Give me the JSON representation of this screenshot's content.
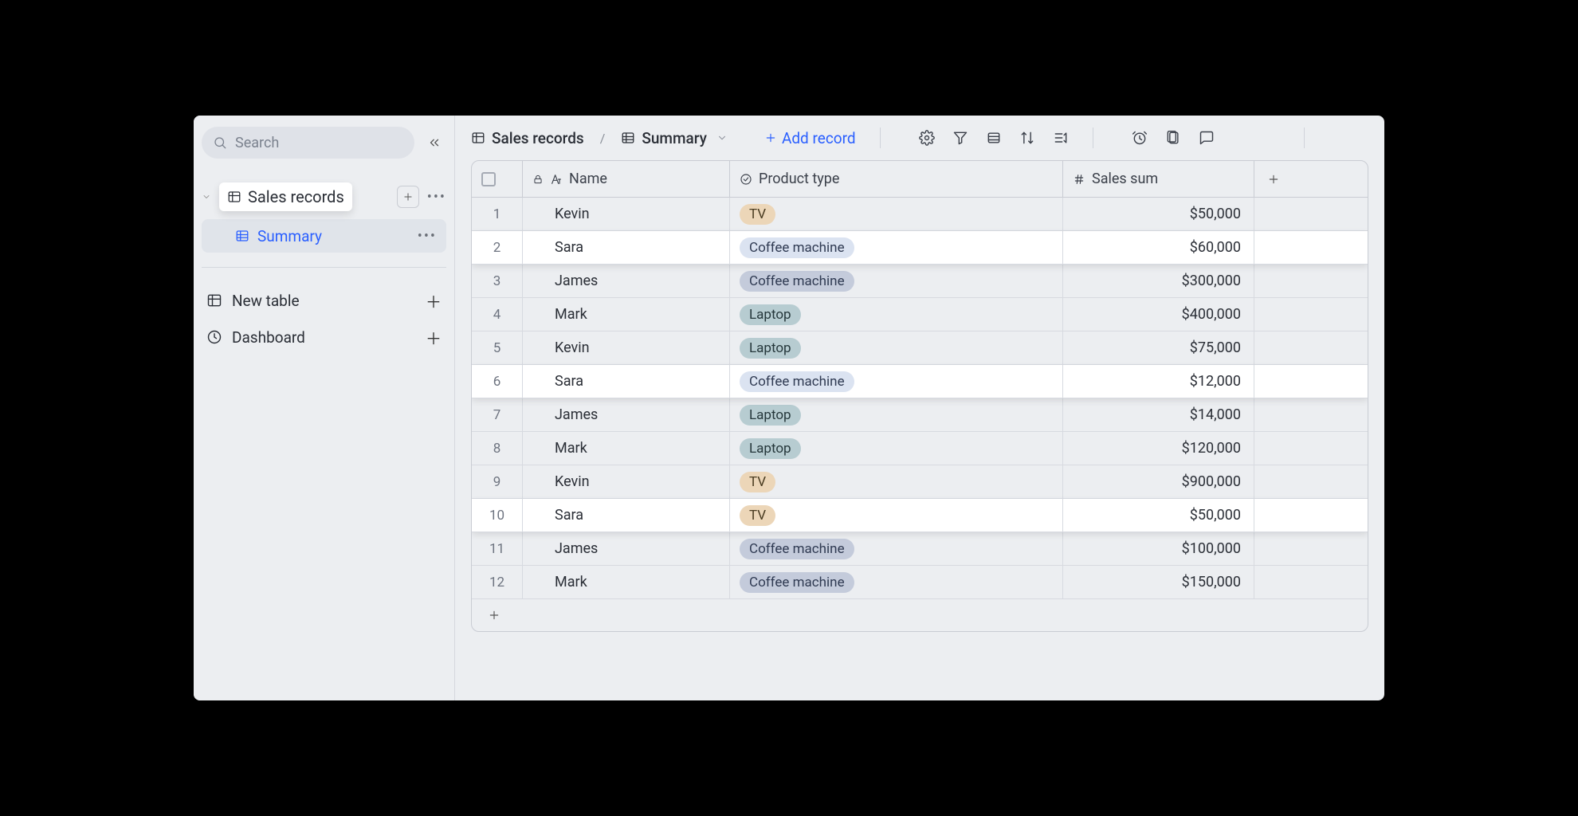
{
  "sidebar": {
    "search_placeholder": "Search",
    "tree": {
      "table_label": "Sales records",
      "view_label": "Summary"
    },
    "items": [
      {
        "icon": "table",
        "label": "New table"
      },
      {
        "icon": "clock",
        "label": "Dashboard"
      }
    ]
  },
  "header": {
    "crumb_table": "Sales records",
    "crumb_view": "Summary",
    "add_record_label": "Add record"
  },
  "table": {
    "columns": [
      {
        "key": "name",
        "label": "Name",
        "icon": "text",
        "locked": true
      },
      {
        "key": "product",
        "label": "Product type",
        "icon": "select"
      },
      {
        "key": "sum",
        "label": "Sales sum",
        "icon": "hash"
      }
    ],
    "rows": [
      {
        "n": 1,
        "name": "Kevin",
        "product": "TV",
        "product_style": "tv",
        "sum": "$50,000",
        "hi": false
      },
      {
        "n": 2,
        "name": "Sara",
        "product": "Coffee machine",
        "product_style": "coffee",
        "sum": "$60,000",
        "hi": true
      },
      {
        "n": 3,
        "name": "James",
        "product": "Coffee machine",
        "product_style": "coffee-g",
        "sum": "$300,000",
        "hi": false
      },
      {
        "n": 4,
        "name": "Mark",
        "product": "Laptop",
        "product_style": "laptop",
        "sum": "$400,000",
        "hi": false
      },
      {
        "n": 5,
        "name": "Kevin",
        "product": "Laptop",
        "product_style": "laptop",
        "sum": "$75,000",
        "hi": false
      },
      {
        "n": 6,
        "name": "Sara",
        "product": "Coffee machine",
        "product_style": "coffee",
        "sum": "$12,000",
        "hi": true
      },
      {
        "n": 7,
        "name": "James",
        "product": "Laptop",
        "product_style": "laptop",
        "sum": "$14,000",
        "hi": false
      },
      {
        "n": 8,
        "name": "Mark",
        "product": "Laptop",
        "product_style": "laptop",
        "sum": "$120,000",
        "hi": false
      },
      {
        "n": 9,
        "name": "Kevin",
        "product": "TV",
        "product_style": "tv",
        "sum": "$900,000",
        "hi": false
      },
      {
        "n": 10,
        "name": "Sara",
        "product": "TV",
        "product_style": "tv",
        "sum": "$50,000",
        "hi": true
      },
      {
        "n": 11,
        "name": "James",
        "product": "Coffee machine",
        "product_style": "coffee-g",
        "sum": "$100,000",
        "hi": false
      },
      {
        "n": 12,
        "name": "Mark",
        "product": "Coffee machine",
        "product_style": "coffee-g",
        "sum": "$150,000",
        "hi": false
      }
    ]
  }
}
